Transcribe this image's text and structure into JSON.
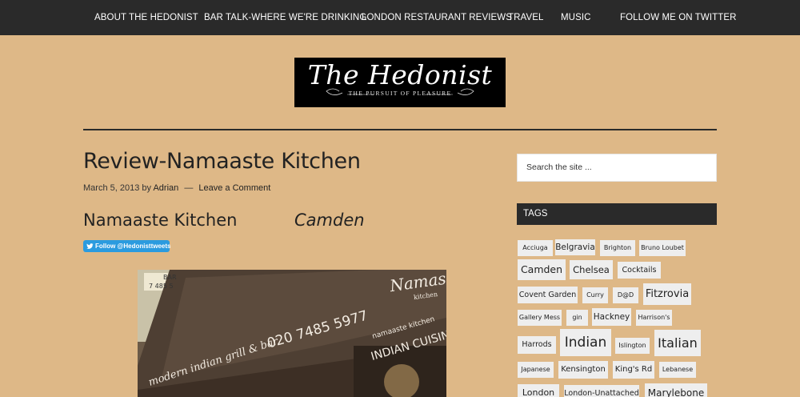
{
  "nav": {
    "items": [
      {
        "label": "ABOUT THE HEDONIST"
      },
      {
        "label": "BAR TALK-WHERE WE'RE DRINKING"
      },
      {
        "label": "LONDON RESTAURANT REVIEWS"
      },
      {
        "label": "TRAVEL"
      },
      {
        "label": "MUSIC"
      },
      {
        "label": "FOLLOW ME ON TWITTER"
      }
    ]
  },
  "header": {
    "logo_title": "The Hedonist",
    "logo_tagline": "THE PURSUIT OF PLEASURE"
  },
  "post": {
    "title": "Review-Namaaste Kitchen",
    "date": "March 5, 2013",
    "by": "by",
    "author": "Adrian",
    "separator": "—",
    "comment_link": "Leave a Comment",
    "heading": "Namaaste  Kitchen",
    "heading_location": "Camden",
    "follow_button": "Follow @Hedonisttweets",
    "photo": {
      "shop_name": "Namaste",
      "shop_sub": "kitchen",
      "phone": "020 7485 5977",
      "tagline": "modern indian grill & bar",
      "sign_line1": "namaaste kitchen",
      "sign_line2": "INDIAN CUISINE",
      "side_sign": "BAR",
      "side_phone": "7 485 5"
    }
  },
  "sidebar": {
    "search_placeholder": "Search the site ...",
    "tags_title": "TAGS",
    "tags": [
      {
        "label": "Acciuga"
      },
      {
        "label": "Belgravia"
      },
      {
        "label": "Brighton"
      },
      {
        "label": "Bruno Loubet"
      },
      {
        "label": "Camden"
      },
      {
        "label": "Chelsea"
      },
      {
        "label": "Cocktails"
      },
      {
        "label": "Covent Garden"
      },
      {
        "label": "Curry"
      },
      {
        "label": "D@D"
      },
      {
        "label": "Fitzrovia"
      },
      {
        "label": "Gallery Mess"
      },
      {
        "label": "gin"
      },
      {
        "label": "Hackney"
      },
      {
        "label": "Harrison's"
      },
      {
        "label": "Harrods"
      },
      {
        "label": "Indian"
      },
      {
        "label": "Islington"
      },
      {
        "label": "Italian"
      },
      {
        "label": "Japanese"
      },
      {
        "label": "Kensington"
      },
      {
        "label": "King's Rd"
      },
      {
        "label": "Lebanese"
      },
      {
        "label": "London"
      },
      {
        "label": "London-Unattached"
      },
      {
        "label": "Marylebone"
      }
    ]
  },
  "colors": {
    "background": "#deb887",
    "nav_bg": "#2a2a2a",
    "follow_button": "#2b9bdf",
    "tag_bg": "#eeeeee"
  }
}
